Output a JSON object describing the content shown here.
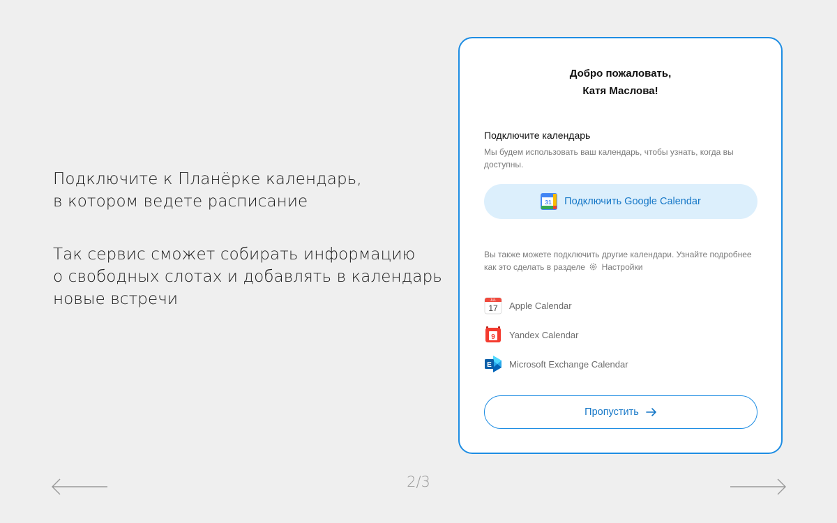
{
  "slide": {
    "paragraph1": "Подключите к Планёрке календарь,\nв котором ведете расписание",
    "paragraph2": "Так сервис сможет собирать информацию\nо свободных слотах и добавлять в календарь\nновые встречи",
    "page_counter": "2/3"
  },
  "card": {
    "welcome": "Добро пожаловать,\nКатя Маслова!",
    "section_title": "Подключите календарь",
    "section_desc": "Мы будем использовать ваш календарь, чтобы узнать, когда вы доступны.",
    "google_button_label": "Подключить Google Calendar",
    "google_icon_number": "31",
    "other_desc_prefix": "Вы также можете подключить другие календари. Узнайте подробнее как это сделать в разделе",
    "settings_link": "Настройки",
    "calendars": [
      {
        "label": "Apple Calendar",
        "icon": "apple-calendar-icon",
        "badge_month": "JUL",
        "badge_day": "17"
      },
      {
        "label": "Yandex Calendar",
        "icon": "yandex-calendar-icon",
        "badge_day": "9"
      },
      {
        "label": "Microsoft Exchange Calendar",
        "icon": "exchange-icon",
        "badge_letter": "E"
      }
    ],
    "skip_label": "Пропустить"
  },
  "colors": {
    "accent": "#1e8de3",
    "button_text": "#1577c7",
    "google_button_bg": "#dceffc",
    "background": "#efefef"
  }
}
